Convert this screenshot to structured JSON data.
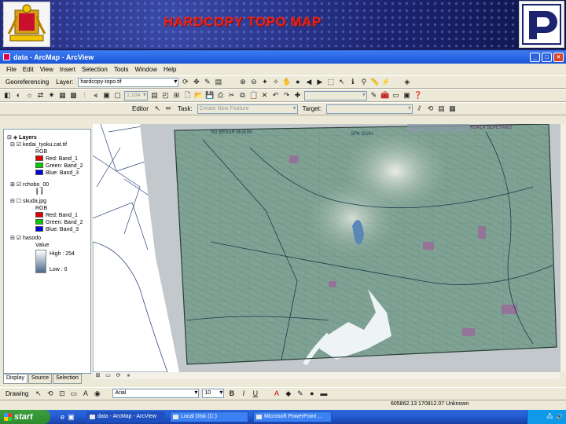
{
  "slide": {
    "title": "HARDCOPY TOPO MAP",
    "colors": {
      "banner": "#1c2470",
      "title": "#e8231a"
    }
  },
  "window": {
    "title": "data - ArcMap - ArcView",
    "controls": {
      "minimize": "_",
      "maximize": "□",
      "close": "×"
    }
  },
  "menu": {
    "items": [
      "File",
      "Edit",
      "View",
      "Insert",
      "Selection",
      "Tools",
      "Window",
      "Help"
    ]
  },
  "georef_toolbar": {
    "label": "Georeferencing",
    "layer_label": "Layer:",
    "layer_value": "hardcopy-topo.tif"
  },
  "tools_toolbar": {
    "scale_value": "1:104",
    "combo_value": ""
  },
  "editor_toolbar": {
    "label": "Editor",
    "task_label": "Task:",
    "task_value": "Create New Feature",
    "target_label": "Target:",
    "target_value": ""
  },
  "toc": {
    "header": "Layers",
    "layers": [
      {
        "name": "kedai_tyoku.cat.tif",
        "renderer": "RGB",
        "bands": [
          {
            "label": "Red:  Band_1",
            "color": "#e00000"
          },
          {
            "label": "Green: Band_2",
            "color": "#00cc00"
          },
          {
            "label": "Blue: Band_3",
            "color": "#0000e0"
          }
        ]
      },
      {
        "name": "rchobo_00",
        "renderer": ""
      },
      {
        "name": "skuda.jpg",
        "renderer": "RGB",
        "bands": [
          {
            "label": "Red:  Band_1",
            "color": "#e00000"
          },
          {
            "label": "Green: Band_2",
            "color": "#00cc00"
          },
          {
            "label": "Blue: Band_3",
            "color": "#0000e0"
          }
        ]
      },
      {
        "name": "hasodo",
        "renderer": "Value",
        "high": "High : 254",
        "low": "Low : 0"
      }
    ],
    "tabs": [
      "Display",
      "Source",
      "Selection"
    ]
  },
  "map": {
    "label_top_left": "SG BESAR MUKIM",
    "label_top_right": "KUALA SEPETANG",
    "label_center": "SPK GUAI"
  },
  "drawing_toolbar": {
    "label": "Drawing",
    "font_value": "Arial",
    "size_value": "10",
    "bold": "B",
    "italic": "I",
    "underline": "U",
    "text_tool": "A"
  },
  "status": {
    "coords": "605862.13  170812.07 Unknown"
  },
  "taskbar": {
    "start": "start",
    "tasks": [
      "data - ArcMap - ArcView",
      "Local Disk (C:)",
      "Microsoft PowerPoint ..."
    ],
    "tray_icons": [
      "network-icon",
      "speaker-icon"
    ]
  }
}
